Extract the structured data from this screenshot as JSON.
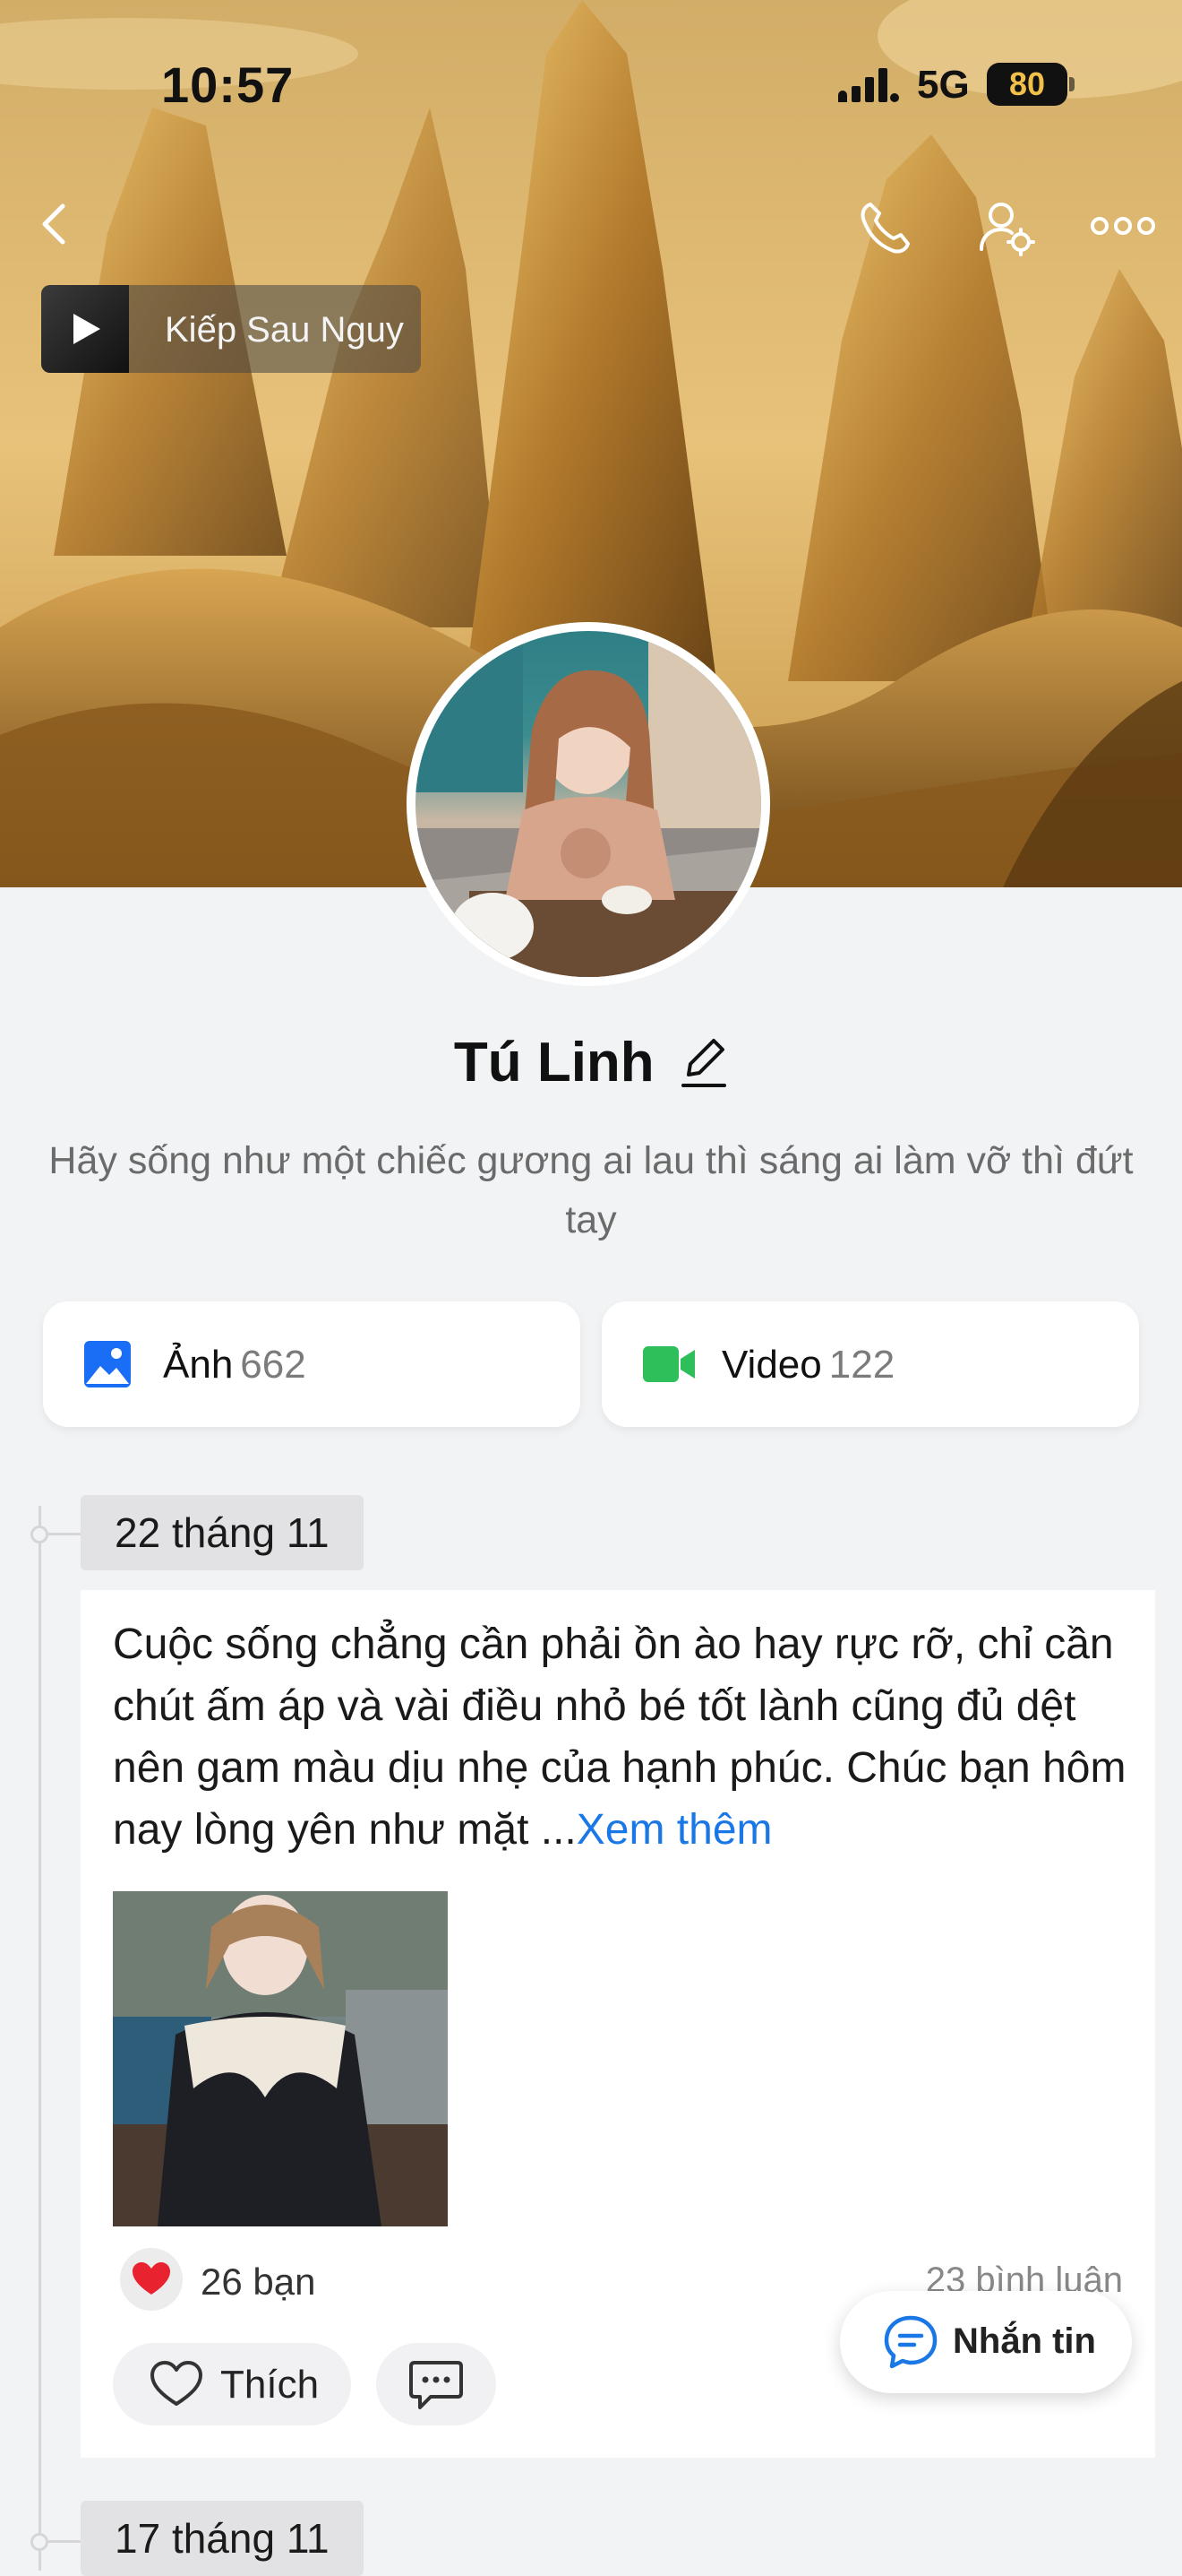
{
  "status_bar": {
    "time": "10:57",
    "network": "5G",
    "battery": "80"
  },
  "nav": {
    "back_icon": "chevron-left-icon",
    "call_icon": "phone-icon",
    "settings_icon": "user-settings-icon",
    "more_icon": "more-dots-icon"
  },
  "music": {
    "title": "Kiếp Sau Nguy"
  },
  "profile": {
    "name": "Tú Linh",
    "bio": "Hãy sống như một chiếc gương  ai lau thì sáng ai làm vỡ thì đứt tay"
  },
  "media": {
    "photos_label": "Ảnh",
    "photos_count": "662",
    "videos_label": "Video",
    "videos_count": "122",
    "photos_color": "#1a6ef5",
    "videos_color": "#2fbf5a"
  },
  "timeline": {
    "dates": [
      "22 tháng 11",
      "17 tháng 11"
    ]
  },
  "post": {
    "text": "Cuộc sống chẳng cần phải ồn ào hay rực rỡ, chỉ cần chút ấm áp và vài điều nhỏ bé tốt lành cũng đủ dệt nên gam màu dịu nhẹ của hạnh phúc. Chúc bạn hôm nay lòng yên như mặt ...",
    "see_more": "Xem thêm",
    "reactions": "26 bạn",
    "comments": "23 bình luận",
    "like_label": "Thích"
  },
  "message_button": {
    "label": "Nhắn tin",
    "accent": "#1a77e6"
  }
}
